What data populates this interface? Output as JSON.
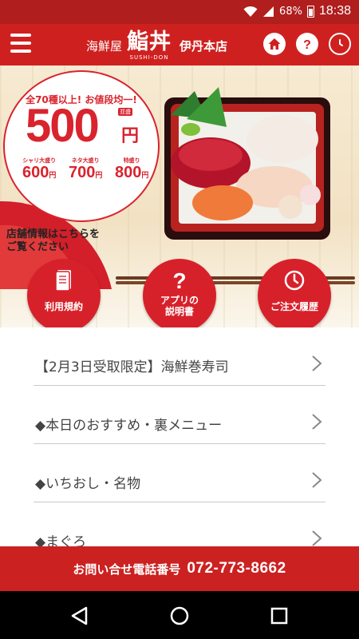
{
  "status_bar": {
    "battery": "68%",
    "time": "18:38"
  },
  "app_bar": {
    "brand_prefix": "海鮮屋",
    "brand_kanji": "鮨丼",
    "brand_romaji": "SUSHI-DON",
    "store_name": "伊丹本店",
    "icons": [
      "home-icon",
      "help-icon",
      "history-icon"
    ]
  },
  "hero": {
    "promo_headline": "全70種以上! お値段均一!",
    "price": "500",
    "price_unit": "円",
    "tax_note": "税抜",
    "tax_badge": "並盛",
    "options": [
      {
        "label": "シャリ大盛り",
        "price": "600",
        "unit": "円"
      },
      {
        "label": "ネタ大盛り",
        "price": "700",
        "unit": "円"
      },
      {
        "label": "特盛り",
        "price": "800",
        "unit": "円"
      }
    ],
    "store_info": "店舗情報はこちらを\nご覧ください"
  },
  "quick_buttons": [
    {
      "label": "利用規約",
      "icon": "document-icon"
    },
    {
      "label": "アプリの\n説明書",
      "icon": "question-icon"
    },
    {
      "label": "ご注文履歴",
      "icon": "clock-icon"
    }
  ],
  "menu": {
    "items": [
      "【2月3日受取限定】海鮮巻寿司",
      "◆本日のおすすめ・裏メニュー",
      "◆いちおし・名物",
      "◆まぐろ"
    ]
  },
  "contact": {
    "label": "お問い合せ電話番号",
    "phone": "072-773-8662"
  },
  "colors": {
    "brand_red": "#cf2020",
    "status_red": "#b01e1e",
    "button_red": "#d7212a"
  }
}
